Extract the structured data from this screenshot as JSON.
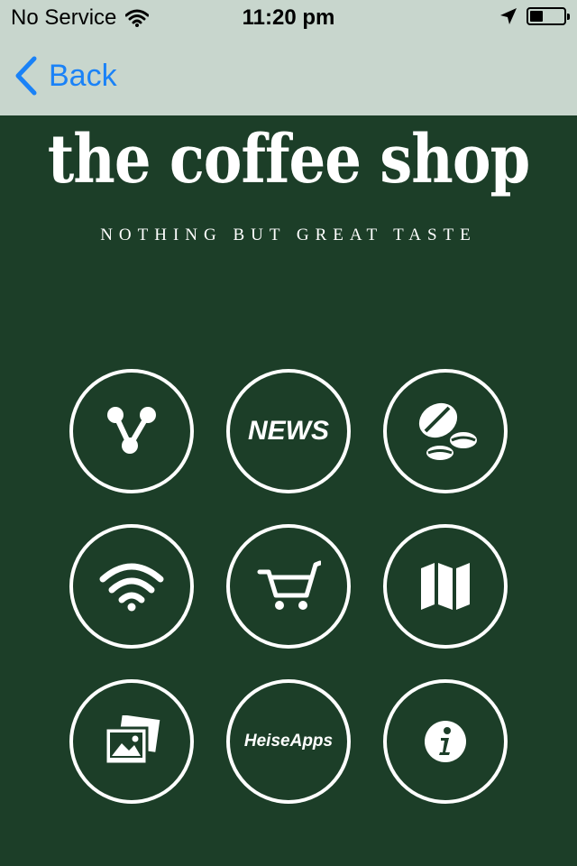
{
  "status_bar": {
    "carrier": "No Service",
    "time": "11:20 pm"
  },
  "nav": {
    "back_label": "Back"
  },
  "brand": {
    "title": "the coffee shop",
    "tagline": "NOTHING BUT GREAT TASTE"
  },
  "grid": {
    "news_label": "NEWS",
    "heise_label": "HeiseApps"
  },
  "colors": {
    "background": "#1c3e28",
    "bar": "#c8d6cd",
    "accent": "#1a82f7",
    "icon": "#ffffff"
  }
}
